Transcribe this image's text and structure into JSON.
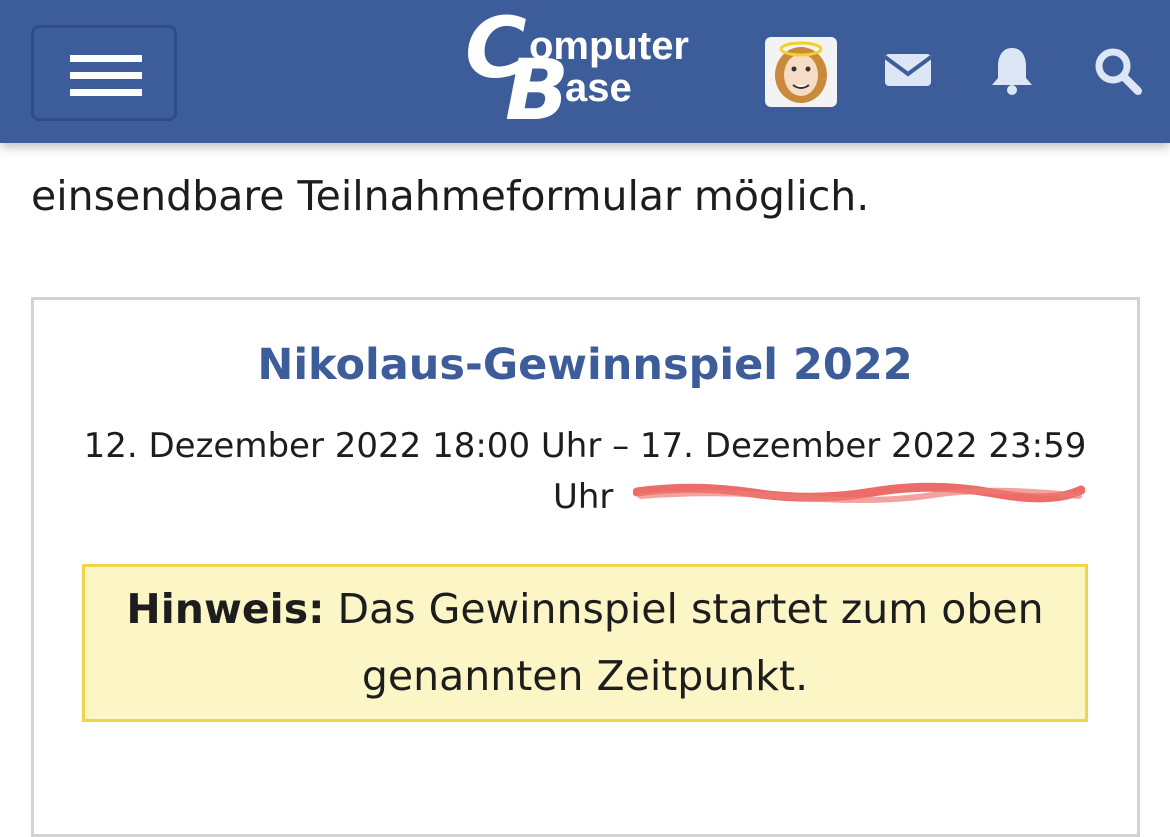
{
  "header": {
    "logo_line1": "omputer",
    "logo_line2": "ase",
    "logo_c": "C",
    "logo_b": "B",
    "background": "#3d5d9a",
    "icons": [
      "menu-icon",
      "avatar",
      "envelope-icon",
      "bell-icon",
      "search-icon"
    ]
  },
  "article": {
    "intro_text": "einsendbare Teilnahmeformular möglich."
  },
  "event_card": {
    "title": "Nikolaus-Gewinnspiel 2022",
    "date_line1": "12. Dezember 2022 18:00 Uhr – 17. Dezember 2022 23:59",
    "date_line2": "Uhr",
    "title_color": "#3d5d9a",
    "note": {
      "label": "Hinweis:",
      "text_line1": " Das Gewinnspiel startet zum oben",
      "text_line2": "genannten Zeitpunkt.",
      "background": "#fcf6c7",
      "border": "#f2d44a"
    }
  }
}
